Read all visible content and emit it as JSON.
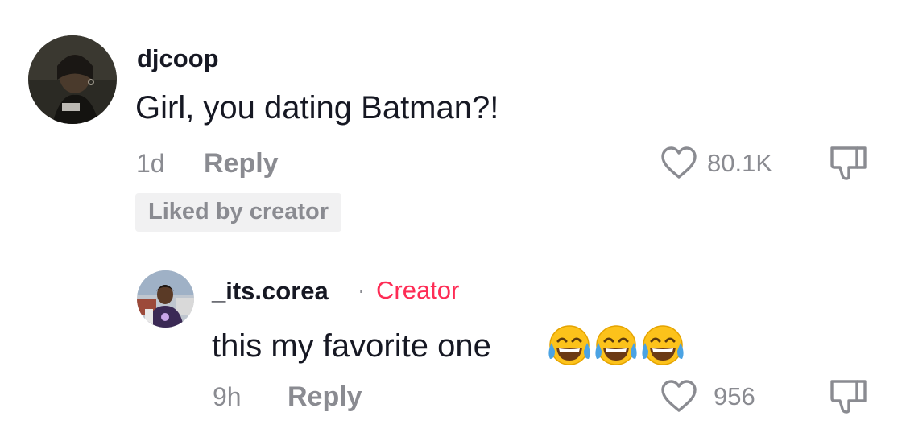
{
  "comment": {
    "username": "djcoop",
    "text": "Girl, you dating Batman?!",
    "time": "1d",
    "reply_label": "Reply",
    "likes": "80.1K",
    "liked_badge": "Liked by creator",
    "avatar_icon": "user-avatar-photo"
  },
  "reply": {
    "username": "_its.corea",
    "separator": "·",
    "creator_label": "Creator",
    "text": "this my favorite one",
    "emojis": [
      "face-with-tears-of-joy",
      "face-with-tears-of-joy",
      "face-with-tears-of-joy"
    ],
    "time": "9h",
    "reply_label": "Reply",
    "likes": "956",
    "avatar_icon": "user-avatar-photo"
  },
  "colors": {
    "text_primary": "#161823",
    "text_secondary": "#8a8b91",
    "creator_accent": "#fe2c55",
    "badge_bg": "#f1f1f2"
  }
}
